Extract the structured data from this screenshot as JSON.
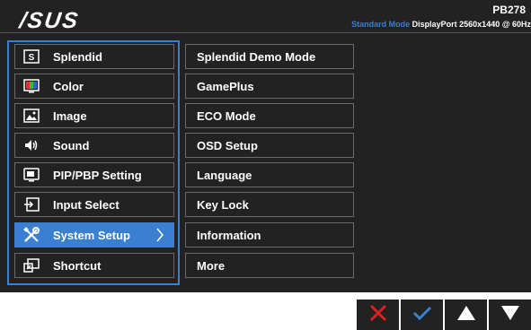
{
  "header": {
    "logo": "/SUS",
    "model": "PB278",
    "mode_label": "Standard Mode",
    "status_info": "DisplayPort  2560x1440 @ 60Hz"
  },
  "main_menu": {
    "items": [
      {
        "label": "Splendid",
        "icon": "splendid-icon"
      },
      {
        "label": "Color",
        "icon": "color-icon"
      },
      {
        "label": "Image",
        "icon": "image-icon"
      },
      {
        "label": "Sound",
        "icon": "sound-icon"
      },
      {
        "label": "PIP/PBP Setting",
        "icon": "pip-icon"
      },
      {
        "label": "Input Select",
        "icon": "input-select-icon"
      },
      {
        "label": "System Setup",
        "icon": "wrench-screwdriver-icon",
        "selected": true
      },
      {
        "label": "Shortcut",
        "icon": "shortcut-icon"
      }
    ]
  },
  "sub_menu": {
    "items": [
      {
        "label": "Splendid Demo Mode"
      },
      {
        "label": "GamePlus"
      },
      {
        "label": "ECO Mode"
      },
      {
        "label": "OSD Setup"
      },
      {
        "label": "Language"
      },
      {
        "label": "Key Lock"
      },
      {
        "label": "Information"
      },
      {
        "label": "More"
      }
    ]
  },
  "nav_buttons": [
    {
      "name": "close-button",
      "icon": "close-icon",
      "color": "#e02020"
    },
    {
      "name": "confirm-button",
      "icon": "check-icon",
      "color": "#3a7fd0"
    },
    {
      "name": "up-button",
      "icon": "triangle-up-icon",
      "color": "#ffffff"
    },
    {
      "name": "down-button",
      "icon": "triangle-down-icon",
      "color": "#ffffff"
    }
  ],
  "colors": {
    "accent": "#3a7fd0",
    "background": "#222222",
    "border": "#6a6a6a"
  }
}
